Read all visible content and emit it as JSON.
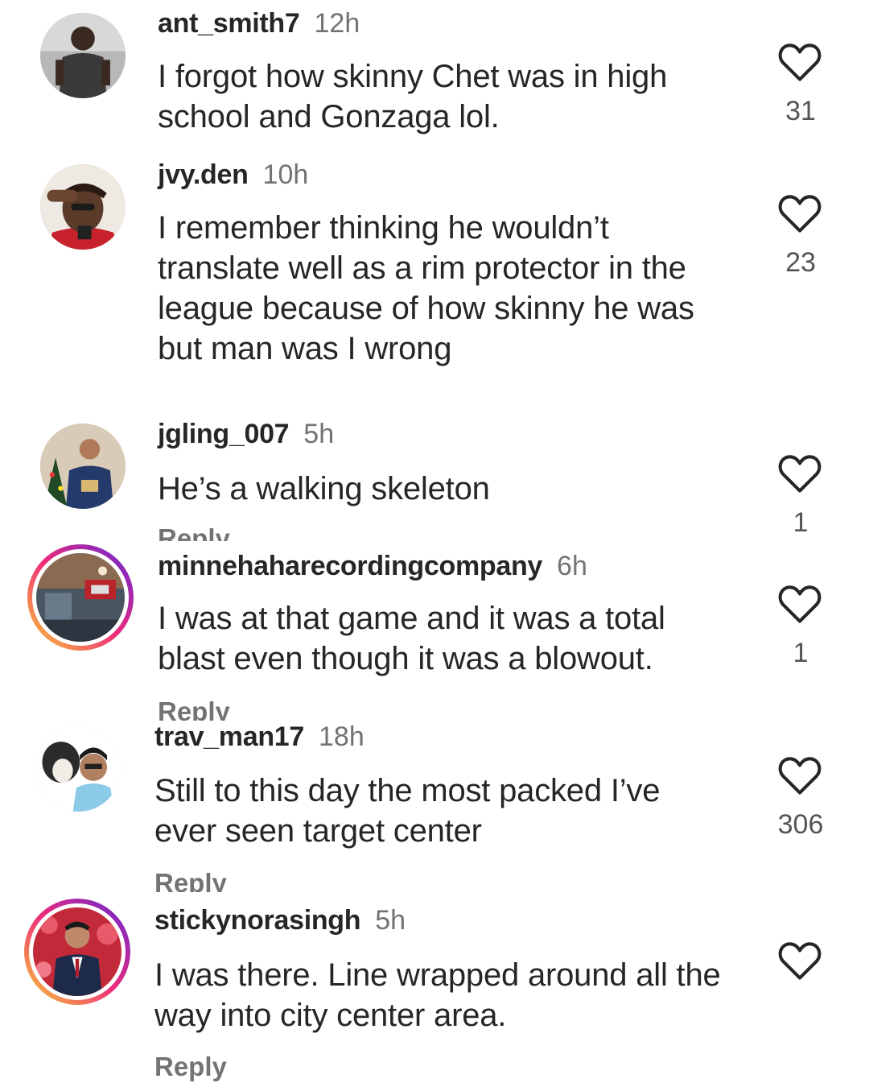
{
  "colors": {
    "text": "#262626",
    "secondary": "#737373",
    "story_ring_start": "#f9ce34",
    "story_ring_mid": "#ee2a7b",
    "story_ring_end": "#6228d7"
  },
  "icons": {
    "like": "heart-outline-icon"
  },
  "comments": [
    {
      "username": "ant_smith7",
      "time": "12h",
      "text": "I forgot how skinny Chet was in high school and Gonzaga lol.",
      "likes": "31",
      "reply_label": ""
    },
    {
      "username": "jvy.den",
      "time": "10h",
      "text": "I remember thinking he wouldn’t translate well as a rim protector in the league because of how skinny he was but man was I wrong",
      "likes": "23",
      "reply_label": ""
    },
    {
      "username": "jgling_007",
      "time": "5h",
      "text": "He’s a walking skeleton",
      "likes": "1",
      "reply_label": "Reply"
    },
    {
      "username": "minnehaharecordingcompany",
      "time": "6h",
      "text": "I was at that game and it was a total blast even though it was a blowout.",
      "likes": "1",
      "reply_label": "Reply"
    },
    {
      "username": "trav_man17",
      "time": "18h",
      "text": "Still to this day the most packed I’ve ever seen target center",
      "likes": "306",
      "reply_label": "Reply"
    },
    {
      "username": "stickynorasingh",
      "time": "5h",
      "text": "I was there.  Line wrapped around all the way into city center area.",
      "likes": "",
      "reply_label": "Reply"
    }
  ]
}
